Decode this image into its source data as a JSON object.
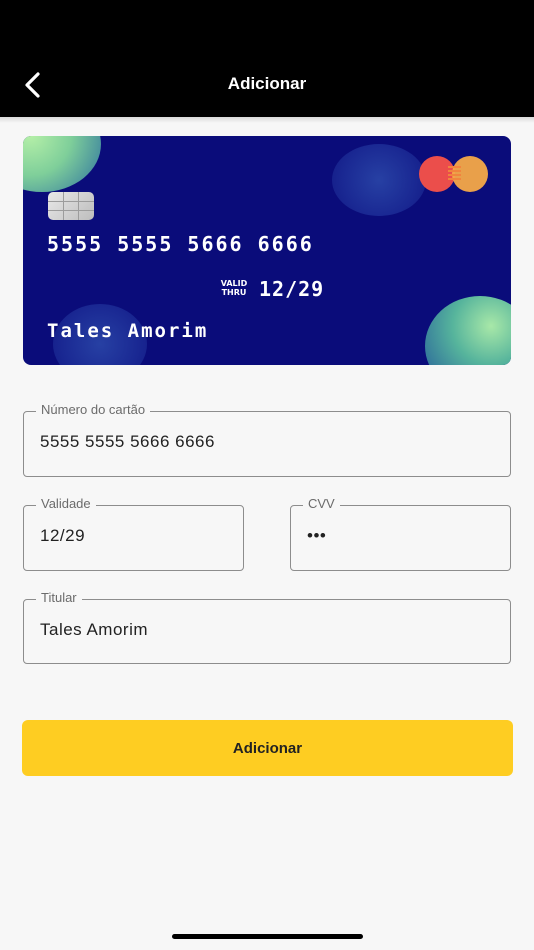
{
  "header": {
    "title": "Adicionar",
    "back_icon": "chevron-left-icon"
  },
  "card": {
    "number": "5555 5555 5666 6666",
    "valid_label_1": "VALID",
    "valid_label_2": "THRU",
    "expiry": "12/29",
    "holder": "Tales Amorim",
    "brand_icon": "mastercard-logo",
    "chip_icon": "card-chip-icon",
    "background_color": "#0a0c7a"
  },
  "form": {
    "number_label": "Número do cartão",
    "number_value": "5555 5555 5666 6666",
    "validity_label": "Validade",
    "validity_value": "12/29",
    "cvv_label": "CVV",
    "cvv_value": "•••",
    "holder_label": "Titular",
    "holder_value": "Tales Amorim"
  },
  "submit": {
    "label": "Adicionar",
    "color": "#fecd22"
  }
}
